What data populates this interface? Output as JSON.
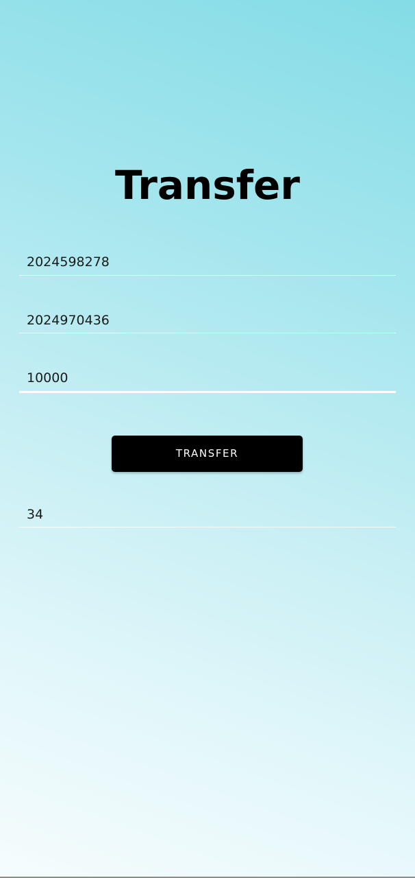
{
  "header": {
    "title": "Transfer"
  },
  "form": {
    "from_account": {
      "value": "2024598278"
    },
    "to_account": {
      "value": "2024970436"
    },
    "amount": {
      "value": "10000"
    },
    "transfer_button_label": "TRANSFER",
    "result": {
      "value": "34"
    }
  },
  "colors": {
    "gradient_top": "#84dce6",
    "gradient_bottom": "#f6fcfd",
    "button_bg": "#000000",
    "button_text": "#ffffff",
    "title_text": "#000000",
    "underline": "#ffffff"
  }
}
